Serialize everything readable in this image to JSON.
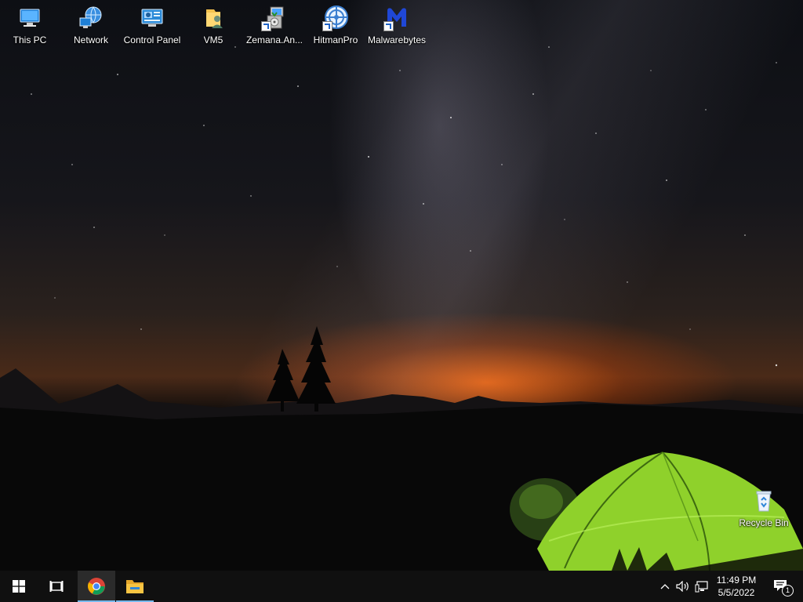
{
  "desktop_icons": [
    {
      "label": "This PC",
      "icon": "this-pc-icon"
    },
    {
      "label": "Network",
      "icon": "network-icon"
    },
    {
      "label": "Control Panel",
      "icon": "control-panel-icon"
    },
    {
      "label": "VM5",
      "icon": "user-folder-icon"
    },
    {
      "label": "Zemana.An...",
      "icon": "installer-icon"
    },
    {
      "label": "HitmanPro",
      "icon": "hitmanpro-icon"
    },
    {
      "label": "Malwarebytes",
      "icon": "malwarebytes-icon"
    },
    {
      "label": "Recycle Bin",
      "icon": "recycle-bin-icon"
    }
  ],
  "taskbar": {
    "start": {
      "icon": "windows-start-icon"
    },
    "task_view": {
      "icon": "task-view-icon"
    },
    "pinned": [
      {
        "icon": "chrome-icon",
        "active": true
      },
      {
        "icon": "file-explorer-icon",
        "active": false
      }
    ],
    "tray": {
      "icons": [
        "chevron-up-icon",
        "speaker-icon",
        "network-tray-icon"
      ],
      "time": "11:49 PM",
      "date": "5/5/2022",
      "notification_count": "1"
    }
  },
  "colors": {
    "taskbar": "#101010",
    "accent": "#76b9ed",
    "tent": "#8fd12b"
  }
}
